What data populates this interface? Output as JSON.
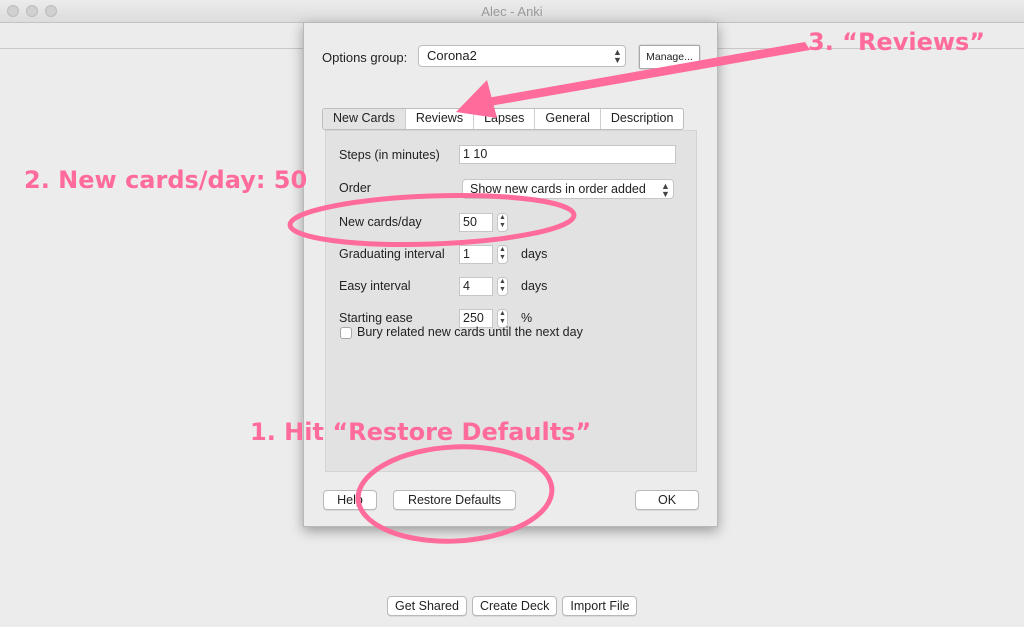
{
  "window": {
    "title": "Alec - Anki"
  },
  "bottom_buttons": [
    "Get Shared",
    "Create Deck",
    "Import File"
  ],
  "dialog": {
    "options_group_label": "Options group:",
    "options_group_value": "Corona2",
    "manage_label": "Manage...",
    "tabs": [
      {
        "label": "New Cards",
        "active": true
      },
      {
        "label": "Reviews",
        "active": false
      },
      {
        "label": "Lapses",
        "active": false
      },
      {
        "label": "General",
        "active": false
      },
      {
        "label": "Description",
        "active": false
      }
    ],
    "fields": {
      "steps_label": "Steps (in minutes)",
      "steps_value": "1 10",
      "order_label": "Order",
      "order_value": "Show new cards in order added",
      "new_per_day_label": "New cards/day",
      "new_per_day_value": "50",
      "graduating_label": "Graduating interval",
      "graduating_value": "1",
      "graduating_unit": "days",
      "easy_label": "Easy interval",
      "easy_value": "4",
      "easy_unit": "days",
      "ease_label": "Starting ease",
      "ease_value": "250",
      "ease_unit": "%",
      "bury_label": "Bury related new cards until the next day",
      "bury_checked": false
    },
    "help_label": "Help",
    "restore_label": "Restore Defaults",
    "ok_label": "OK"
  },
  "annotations": {
    "step1": "1. Hit “Restore Defaults”",
    "step2": "2. New cards/day: 50",
    "step3": "3. “Reviews”",
    "color": "#ff6b9a"
  }
}
